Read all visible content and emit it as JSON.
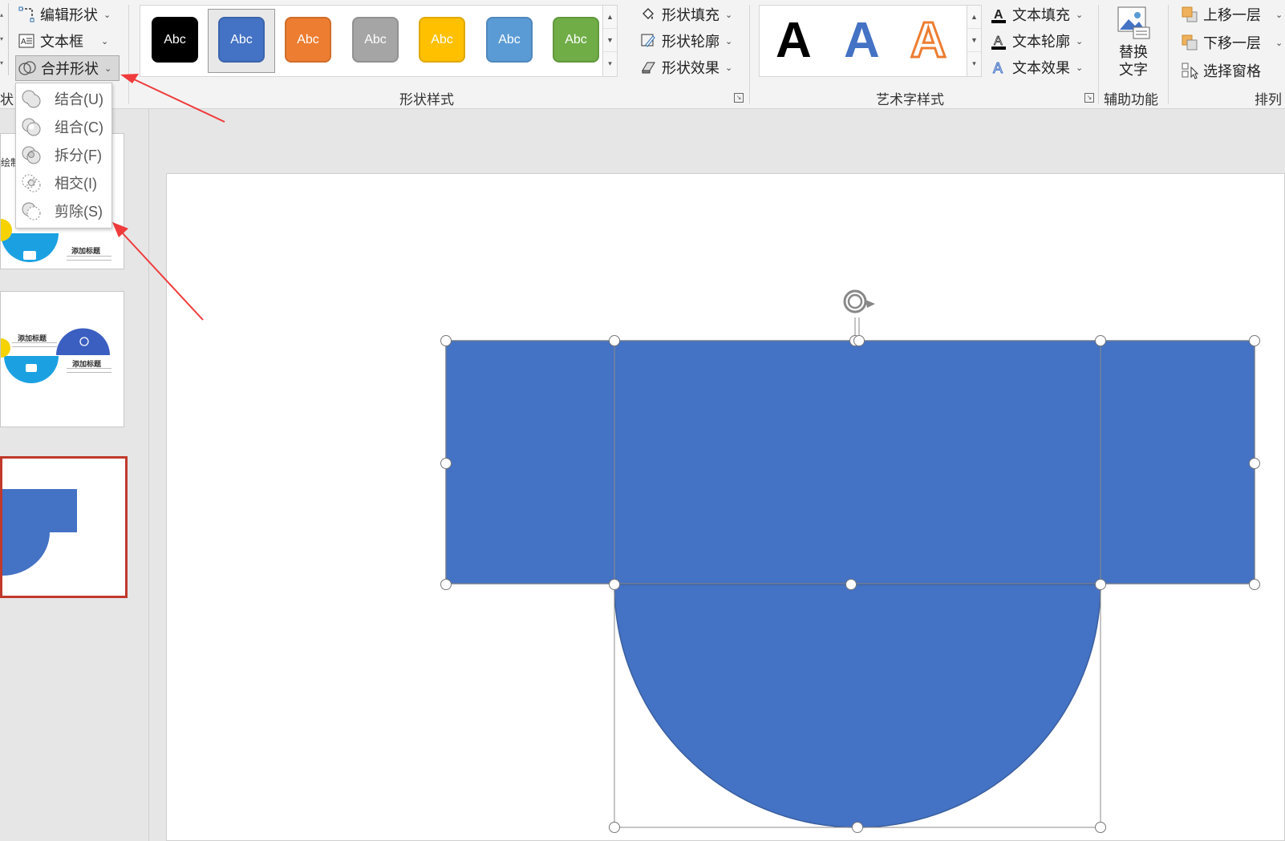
{
  "ribbon": {
    "left_col": {
      "edit_shape": "编辑形状",
      "textbox": "文本框",
      "merge_shapes": "合并形状",
      "group_label_partial": "状"
    },
    "shape_styles": {
      "swatches": [
        {
          "label": "Abc",
          "color": "#000000"
        },
        {
          "label": "Abc",
          "color": "#4472c4"
        },
        {
          "label": "Abc",
          "color": "#ed7d31"
        },
        {
          "label": "Abc",
          "color": "#a5a5a5"
        },
        {
          "label": "Abc",
          "color": "#ffc000"
        },
        {
          "label": "Abc",
          "color": "#5b9bd5"
        },
        {
          "label": "Abc",
          "color": "#70ad47"
        }
      ],
      "shape_fill": "形状填充",
      "shape_outline": "形状轮廓",
      "shape_effects": "形状效果",
      "group_label": "形状样式"
    },
    "wordart": {
      "letters": [
        "A",
        "A",
        "A"
      ],
      "text_fill": "文本填充",
      "text_outline": "文本轮廓",
      "text_effects": "文本效果",
      "group_label": "艺术字样式"
    },
    "accessibility": {
      "alt_text_line1": "替换",
      "alt_text_line2": "文字",
      "group_label": "辅助功能"
    },
    "arrange": {
      "bring_forward": "上移一层",
      "send_backward": "下移一层",
      "selection_pane": "选择窗格",
      "group_label": "排列"
    }
  },
  "merge_menu": {
    "items": [
      {
        "label": "结合(U)"
      },
      {
        "label": "组合(C)"
      },
      {
        "label": "拆分(F)"
      },
      {
        "label": "相交(I)"
      },
      {
        "label": "剪除(S)"
      }
    ]
  },
  "thumbnails": {
    "slide_a": {
      "partial_text": "绘制",
      "title": "添加标题"
    },
    "slide_b": {
      "title1": "添加标题",
      "title2": "添加标题"
    }
  },
  "colors": {
    "shape_fill": "#4472c4",
    "annotation_arrow": "#ef3b3b",
    "selected_thumb_border": "#c0392b"
  }
}
